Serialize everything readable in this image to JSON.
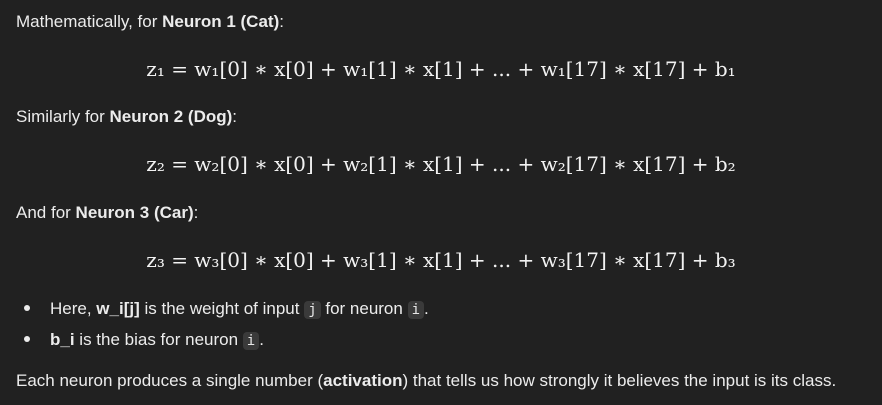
{
  "intro": {
    "prefix": "Mathematically, for ",
    "bold": "Neuron 1 (Cat)",
    "suffix": ":"
  },
  "eq1": "z₁ = w₁[0] ∗ x[0] + w₁[1] ∗ x[1] + ... + w₁[17] ∗ x[17] + b₁",
  "similar": {
    "prefix": "Similarly for ",
    "bold": "Neuron 2 (Dog)",
    "suffix": ":"
  },
  "eq2": "z₂ = w₂[0] ∗ x[0] + w₂[1] ∗ x[1] + ... + w₂[17] ∗ x[17] + b₂",
  "andfor": {
    "prefix": "And for ",
    "bold": "Neuron 3 (Car)",
    "suffix": ":"
  },
  "eq3": "z₃ = w₃[0] ∗ x[0] + w₃[1] ∗ x[1] + ... + w₃[17] ∗ x[17] + b₃",
  "bullets": [
    {
      "prefix": "Here, ",
      "bold": "w_i[j]",
      "mid": " is the weight of input ",
      "code1": "j",
      "mid2": " for neuron ",
      "code2": "i",
      "suffix": "."
    },
    {
      "bold": "b_i",
      "mid": " is the bias for neuron ",
      "code": "i",
      "suffix": "."
    }
  ],
  "closing": {
    "prefix": "Each neuron produces a single number (",
    "bold": "activation",
    "suffix": ") that tells us how strongly it believes the input is its class."
  }
}
